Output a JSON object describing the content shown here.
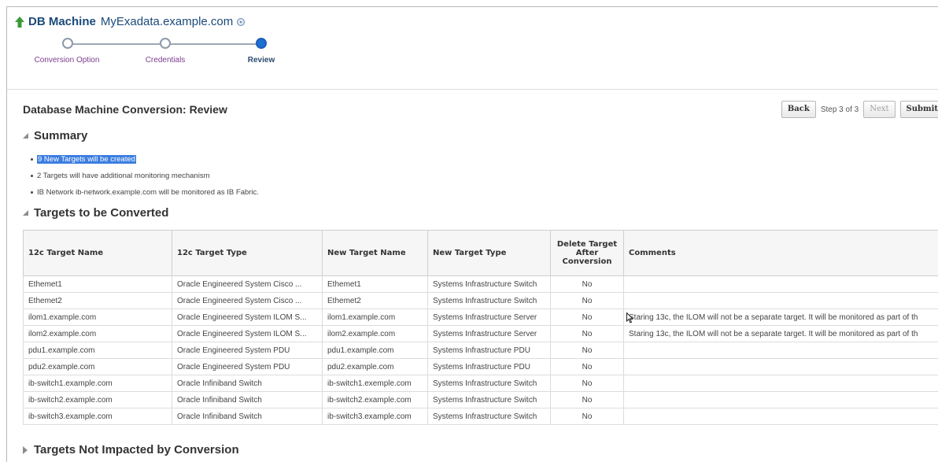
{
  "header": {
    "label": "DB Machine",
    "host": "MyExadata.example.com"
  },
  "train": {
    "steps": [
      "Conversion Option",
      "Credentials",
      "Review"
    ],
    "current": 3
  },
  "page_title": "Database Machine Conversion: Review",
  "nav": {
    "back": "Back",
    "step_text": "Step 3 of 3",
    "next": "Next",
    "submit": "Submit"
  },
  "summary": {
    "title": "Summary",
    "items": [
      "9 New Targets will be created",
      "2 Targets will have additional monitoring mechanism",
      "IB Network  ib-network.example.com  will be monitored as IB Fabric."
    ]
  },
  "targets": {
    "title": "Targets to be Converted",
    "columns": [
      "12c Target Name",
      "12c Target Type",
      "New Target Name",
      "New Target Type",
      "Delete Target After Conversion",
      "Comments"
    ],
    "rows": [
      [
        "Ethemet1",
        "Oracle Engineered System Cisco ...",
        "Ethemet1",
        "Systems Infrastructure Switch",
        "No",
        ""
      ],
      [
        "Ethemet2",
        "Oracle Engineered System Cisco ...",
        "Ethemet2",
        "Systems Infrastructure Switch",
        "No",
        ""
      ],
      [
        "ilom1.example.com",
        "Oracle Engineered System ILOM S...",
        "ilom1.example.com",
        "Systems Infrastructure Server",
        "No",
        "Staring 13c, the ILOM will not be a separate target. It will be monitored as part of th"
      ],
      [
        "ilom2.example.com",
        "Oracle Engineered System ILOM S...",
        "ilom2.example.com",
        "Systems Infrastructure Server",
        "No",
        "Staring 13c, the ILOM will not be a separate target. It will be monitored as part of th"
      ],
      [
        "pdu1.example.com",
        "Oracle Engineered System PDU",
        "pdu1.example.com",
        "Systems Infrastructure PDU",
        "No",
        ""
      ],
      [
        "pdu2.example.com",
        "Oracle Engineered System PDU",
        "pdu2.example.com",
        "Systems Infrastructure PDU",
        "No",
        ""
      ],
      [
        "ib-switch1.example.com",
        "Oracle Infiniband Switch",
        "ib-switch1.exemple.com",
        "Systems Infrastructure Switch",
        "No",
        ""
      ],
      [
        "ib-switch2.example.com",
        "Oracle Infiniband Switch",
        "ib-switch2.example.com",
        "Systems Infrastructure Switch",
        "No",
        ""
      ],
      [
        "ib-switch3.example.com",
        "Oracle Infiniband Switch",
        "ib-switch3.example.com",
        "Systems Infrastructure Switch",
        "No",
        ""
      ]
    ]
  },
  "not_impacted": {
    "title": "Targets Not Impacted by Conversion"
  },
  "colors": {
    "title_blue": "#1a4a7a",
    "train_current": "#1f6fd5",
    "link_purple": "#7b3d8f",
    "selection": "#3b7de0"
  }
}
